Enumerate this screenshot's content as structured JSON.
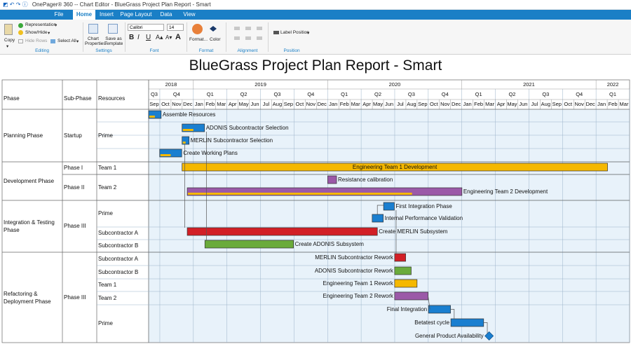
{
  "window": {
    "title": "OnePager® 360 -- Chart Editor - BlueGrass Project Plan Report - Smart"
  },
  "tabs": [
    "File",
    "Home",
    "Insert",
    "Page Layout",
    "Data",
    "View"
  ],
  "active_tab": "Home",
  "ribbon": {
    "copy": "Copy",
    "representation": "Representation",
    "show_hide": "Show/Hide",
    "hide_rows": "Hide Rows",
    "select_all": "Select All",
    "chart_properties": "Chart Properties",
    "save_as_template": "Save as Template",
    "font_name": "Calibri",
    "font_size": "14",
    "bold": "B",
    "italic": "I",
    "underline": "U",
    "format": "Format...",
    "color": "Color",
    "label_position": "Label Position",
    "groups": [
      "Editing",
      "Settings",
      "Font",
      "Format",
      "Alignment",
      "Position"
    ]
  },
  "chart_title": "BlueGrass Project Plan Report - Smart",
  "columns": [
    "Phase",
    "Sub-Phase",
    "Resources"
  ],
  "timescale": {
    "years": [
      "2018",
      "2019",
      "2020",
      "2021",
      "2022"
    ],
    "quarters": [
      "Q3",
      "Q4",
      "Q1",
      "Q2",
      "Q3",
      "Q4",
      "Q1",
      "Q2",
      "Q3",
      "Q4",
      "Q1",
      "Q2",
      "Q3",
      "Q4",
      "Q1"
    ],
    "months": [
      "Sep",
      "Oct",
      "Nov",
      "Dec",
      "Jan",
      "Feb",
      "Mar",
      "Apr",
      "May",
      "Jun",
      "Jul",
      "Aug",
      "Sep",
      "Oct",
      "Nov",
      "Dec",
      "Jan",
      "Feb",
      "Mar",
      "Apr",
      "May",
      "Jun",
      "Jul",
      "Aug",
      "Sep",
      "Oct",
      "Nov",
      "Dec",
      "Jan",
      "Feb",
      "Mar",
      "Apr",
      "May",
      "Jun",
      "Jul",
      "Aug",
      "Sep",
      "Oct",
      "Nov",
      "Dec",
      "Jan",
      "Feb",
      "Mar"
    ]
  },
  "phases": [
    "Planning Phase",
    "Development Phase",
    "Integration & Testing Phase",
    "Refactoring & Deployment Phase"
  ],
  "subphases": [
    "Startup",
    "Phase I",
    "Phase II",
    "Phase III",
    "Phase III"
  ],
  "resources": [
    "Prime",
    "Team 1",
    "Team 2",
    "Prime",
    "Subcontractor A",
    "Subcontractor B",
    "Subcontractor A",
    "Subcontractor B",
    "Team 1",
    "Team 2",
    "Prime"
  ],
  "tasks": [
    {
      "name": "Assemble Resources",
      "start": "2018-09-01",
      "end": "2018-10-05",
      "color": "#1a7fd0",
      "progress": 0.5,
      "label_side": "right"
    },
    {
      "name": "ADONIS Subcontractor Selection",
      "start": "2018-12-01",
      "end": "2019-01-31",
      "color": "#1a7fd0",
      "progress": 0.5,
      "label_side": "right"
    },
    {
      "name": "MERLIN Subcontractor Selection",
      "start": "2018-12-01",
      "end": "2018-12-20",
      "color": "#1a7fd0",
      "progress": 0.5,
      "label_side": "right"
    },
    {
      "name": "Create Working Plans",
      "start": "2018-10-01",
      "end": "2018-11-30",
      "color": "#1a7fd0",
      "progress": 0.5,
      "label_side": "right"
    },
    {
      "name": "Engineering Team 1 Development",
      "start": "2018-12-01",
      "end": "2022-01-31",
      "color": "#f5b800",
      "progress": 0.0,
      "label_side": "inside"
    },
    {
      "name": "Resistance calibration",
      "start": "2020-01-01",
      "end": "2020-01-25",
      "color": "#9b59a8",
      "progress": 0.0,
      "label_side": "right"
    },
    {
      "name": "Engineering Team 2 Development",
      "start": "2018-12-15",
      "end": "2020-12-31",
      "color": "#9b59a8",
      "progress": 0.82,
      "label_side": "right"
    },
    {
      "name": "First Integration Phase",
      "start": "2020-06-01",
      "end": "2020-06-30",
      "color": "#1a7fd0",
      "progress": 0.0,
      "label_side": "right"
    },
    {
      "name": "Internal Performance Validation",
      "start": "2020-05-01",
      "end": "2020-05-31",
      "color": "#1a7fd0",
      "progress": 0.0,
      "label_side": "right"
    },
    {
      "name": "Create MERLIN Subsystem",
      "start": "2018-12-15",
      "end": "2020-05-15",
      "color": "#d21f26",
      "progress": 0.0,
      "label_side": "right"
    },
    {
      "name": "Create ADONIS Subsystem",
      "start": "2019-02-01",
      "end": "2019-09-30",
      "color": "#6aab3b",
      "progress": 0.0,
      "label_side": "right"
    },
    {
      "name": "MERLIN Subcontractor Rework",
      "start": "2020-07-01",
      "end": "2020-07-31",
      "color": "#d21f26",
      "progress": 0.0,
      "label_side": "left"
    },
    {
      "name": "ADONIS Subcontractor Rework",
      "start": "2020-07-01",
      "end": "2020-08-15",
      "color": "#6aab3b",
      "progress": 0.0,
      "label_side": "left"
    },
    {
      "name": "Engineering Team 1 Rework",
      "start": "2020-07-01",
      "end": "2020-08-31",
      "color": "#f5b800",
      "progress": 0.0,
      "label_side": "left"
    },
    {
      "name": "Engineering Team 2 Rework",
      "start": "2020-07-01",
      "end": "2020-09-30",
      "color": "#9b59a8",
      "progress": 0.0,
      "label_side": "left"
    },
    {
      "name": "Final Integration",
      "start": "2020-10-01",
      "end": "2020-11-30",
      "color": "#1a7fd0",
      "progress": 0.0,
      "label_side": "left"
    },
    {
      "name": "Betatest cycle",
      "start": "2020-12-01",
      "end": "2021-02-28",
      "color": "#1a7fd0",
      "progress": 0.0,
      "label_side": "left"
    },
    {
      "name": "General Product Availability",
      "start": "2021-03-15",
      "end": "2021-03-15",
      "color": "#1a7fd0",
      "progress": 0.0,
      "label_side": "left",
      "milestone": true
    }
  ]
}
